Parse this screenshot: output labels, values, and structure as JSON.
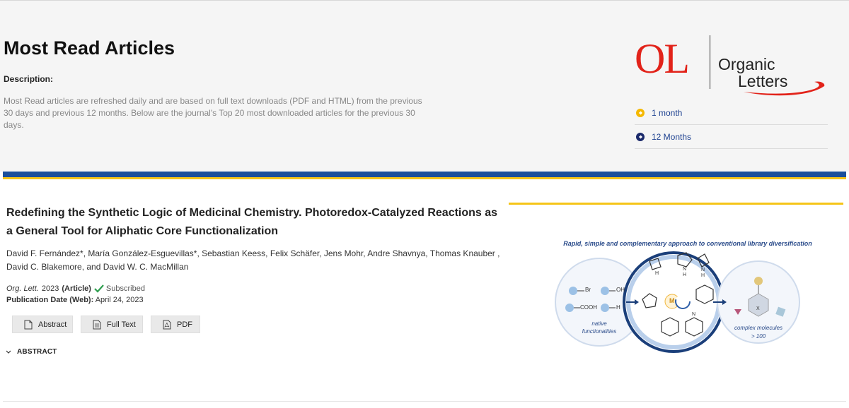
{
  "header": {
    "title": "Most Read Articles",
    "description_label": "Description:",
    "description_text": "Most Read articles are refreshed daily and are based on full text downloads (PDF and HTML) from the previous 30 days and previous 12 months. Below are the journal's Top 20 most downloaded articles for the previous 30 days."
  },
  "logo": {
    "abbr": "OL",
    "name_line1": "Organic",
    "name_line2": "Letters"
  },
  "periods": [
    {
      "label": "1 month",
      "icon": "arrow-right-circle-icon",
      "color": "#f5b800"
    },
    {
      "label": "12 Months",
      "icon": "arrow-right-circle-icon",
      "color": "#1b2a6b"
    }
  ],
  "colors": {
    "accent_blue": "#1b4f9b",
    "accent_yellow": "#f5c518",
    "link": "#1b3f8f",
    "logo_red": "#e2231a",
    "check_green": "#2e9e4f"
  },
  "article": {
    "title": "Redefining the Synthetic Logic of Medicinal Chemistry. Photoredox-Catalyzed Reactions as a General Tool for Aliphatic Core Functionalization",
    "authors": "David F. Fernández*, María González-Esguevillas*, Sebastian Keess, Felix Schäfer, Jens Mohr, Andre Shavnya, Thomas Knauber , David C. Blakemore, and David W. C. MacMillan",
    "journal": "Org. Lett.",
    "year": "2023",
    "type": "(Article)",
    "access": "Subscribed",
    "pub_date_label": "Publication Date (Web):",
    "pub_date": "April 24, 2023",
    "buttons": {
      "abstract": "Abstract",
      "full_text": "Full Text",
      "pdf": "PDF"
    },
    "abstract_toggle": "ABSTRACT"
  },
  "toc_graphic": {
    "caption": "Rapid, simple and complementary approach to conventional library diversification",
    "left_labels": [
      "Br",
      "OH",
      "COOH",
      "H"
    ],
    "left_caption_line1": "native",
    "left_caption_line2": "functionalities",
    "center_badge": "M",
    "right_caption_line1": "complex molecules",
    "right_caption_line2": "> 100",
    "atom_labels": [
      "H",
      "N",
      "N",
      "N",
      "H",
      "H",
      "X"
    ]
  }
}
